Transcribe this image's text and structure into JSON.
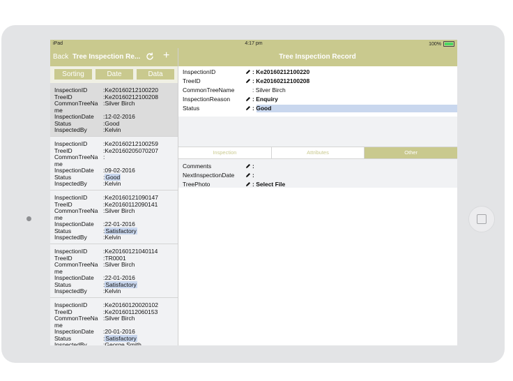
{
  "status_bar": {
    "device": "iPad",
    "time": "4:17 pm",
    "battery": "100%"
  },
  "nav": {
    "back_label": "Back",
    "left_title": "Tree Inspection Re...",
    "right_title": "Tree Inspection Record"
  },
  "sort_buttons": [
    "Sorting",
    "Date",
    "Data"
  ],
  "list": [
    {
      "InspectionID": "Ke20160212100220",
      "TreeID": "Ke20160212100208",
      "CommonTreeName": "Silver Birch",
      "InspectionDate": "12-02-2016",
      "Status": "Good",
      "InspectedBy": "Kelvin"
    },
    {
      "InspectionID": "Ke20160212100259",
      "TreeID": "Ke20160205070207",
      "CommonTreeName": "",
      "InspectionDate": "09-02-2016",
      "Status": "Good",
      "InspectedBy": "Kelvin"
    },
    {
      "InspectionID": "Ke20160121090147",
      "TreeID": "Ke20160112090141",
      "CommonTreeName": "Silver Birch",
      "InspectionDate": "22-01-2016",
      "Status": "Satisfactory",
      "InspectedBy": "Kelvin"
    },
    {
      "InspectionID": "Ke20160121040114",
      "TreeID": "TR0001",
      "CommonTreeName": "Silver Birch",
      "InspectionDate": "22-01-2016",
      "Status": "Satisfactory",
      "InspectedBy": "Kelvin"
    },
    {
      "InspectionID": "Ke20160120020102",
      "TreeID": "Ke20160112060153",
      "CommonTreeName": "Silver Birch",
      "InspectionDate": "20-01-2016",
      "Status": "Satisfactory",
      "InspectedBy": "George Smith"
    }
  ],
  "list_labels": {
    "InspectionID": "InspectionID",
    "TreeID": "TreeID",
    "CommonTreeName1": "CommonTreeNa",
    "CommonTreeName2": "me",
    "InspectionDate": "InspectionDate",
    "Status": "Status",
    "InspectedBy": "InspectedBy"
  },
  "detail": {
    "fields": [
      {
        "label": "InspectionID",
        "value": "Ke20160212100220",
        "editable": true
      },
      {
        "label": "TreeID",
        "value": "Ke20160212100208",
        "editable": true
      },
      {
        "label": "CommonTreeName",
        "value": "Silver Birch",
        "editable": false
      },
      {
        "label": "InspectionReason",
        "value": "Enquiry",
        "editable": true
      },
      {
        "label": "Status",
        "value": "Good",
        "editable": true
      }
    ],
    "tabs": [
      "Inspection",
      "Attributes",
      "Other"
    ],
    "active_tab": "Other",
    "other_fields": [
      {
        "label": "Comments",
        "value": ""
      },
      {
        "label": "NextInspectionDate",
        "value": ""
      },
      {
        "label": "TreePhoto",
        "value": "Select File"
      }
    ]
  },
  "colors": {
    "accent": "#c9c98e",
    "highlight": "#c9d7ee",
    "list_bg": "#f1f2f4"
  }
}
